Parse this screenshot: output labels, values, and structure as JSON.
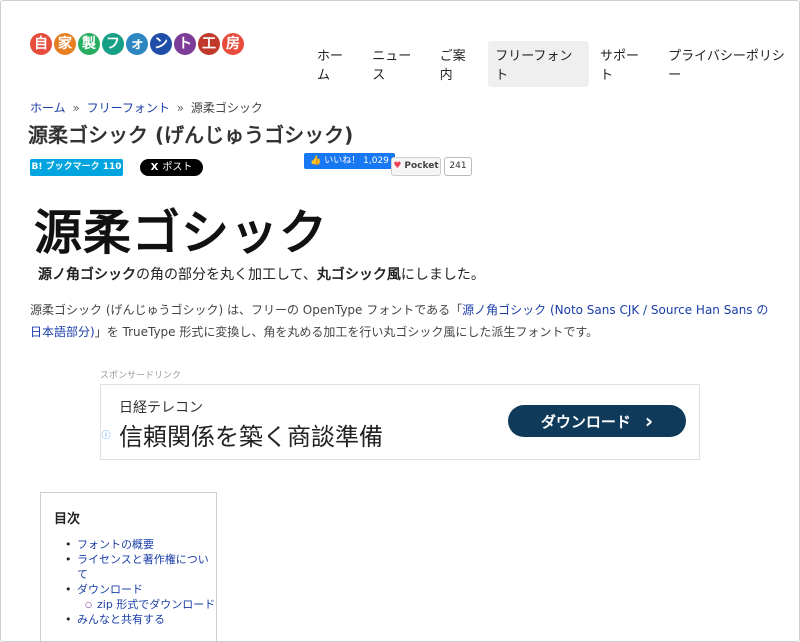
{
  "header": {
    "logo_chars": [
      {
        "ch": "自",
        "color": "#e74c3c"
      },
      {
        "ch": "家",
        "color": "#e67e22"
      },
      {
        "ch": "製",
        "color": "#27ae60"
      },
      {
        "ch": "フ",
        "color": "#16a085"
      },
      {
        "ch": "ォ",
        "color": "#2e86c1"
      },
      {
        "ch": "ン",
        "color": "#1f4ea8"
      },
      {
        "ch": "ト",
        "color": "#7d3c98"
      },
      {
        "ch": "工",
        "color": "#c0392b"
      },
      {
        "ch": "房",
        "color": "#e74c3c"
      }
    ],
    "nav": [
      "ホーム",
      "ニュース",
      "ご案内",
      "フリーフォント",
      "サポート",
      "プライバシーポリシー"
    ]
  },
  "breadcrumb": {
    "home": "ホーム",
    "sep": "»",
    "category": "フリーフォント",
    "current": "源柔ゴシック"
  },
  "page_title": "源柔ゴシック (げんじゅうゴシック)",
  "share": {
    "hatena": "B! ブックマーク 110",
    "x": "ポスト",
    "x_icon": "X",
    "like": "いいね！ 1,029",
    "pocket": "Pocket",
    "pocket_count": "241"
  },
  "hero": {
    "title": "源柔ゴシック",
    "sub_part1": "源ノ角ゴシック",
    "sub_part2": "の角の部分を丸く加工して、",
    "sub_part3": "丸ゴシック風",
    "sub_part4": "にしました。"
  },
  "description": {
    "before": "源柔ゴシック (げんじゅうゴシック) は、フリーの OpenType フォントである「",
    "link": "源ノ角ゴシック (Noto Sans CJK / Source Han Sans の日本語部分)",
    "after": "」を TrueType 形式に変換し、角を丸める加工を行い丸ゴシック風にした派生フォントです。"
  },
  "ad": {
    "label": "スポンサードリンク",
    "brand": "日経テレコン",
    "headline": "信頼関係を築く商談準備",
    "button": "ダウンロード",
    "chevron": "›"
  },
  "toc": {
    "title": "目次",
    "items": [
      "フォントの概要",
      "ライセンスと著作権について",
      "ダウンロード",
      "zip 形式でダウンロード",
      "みんなと共有する"
    ]
  }
}
